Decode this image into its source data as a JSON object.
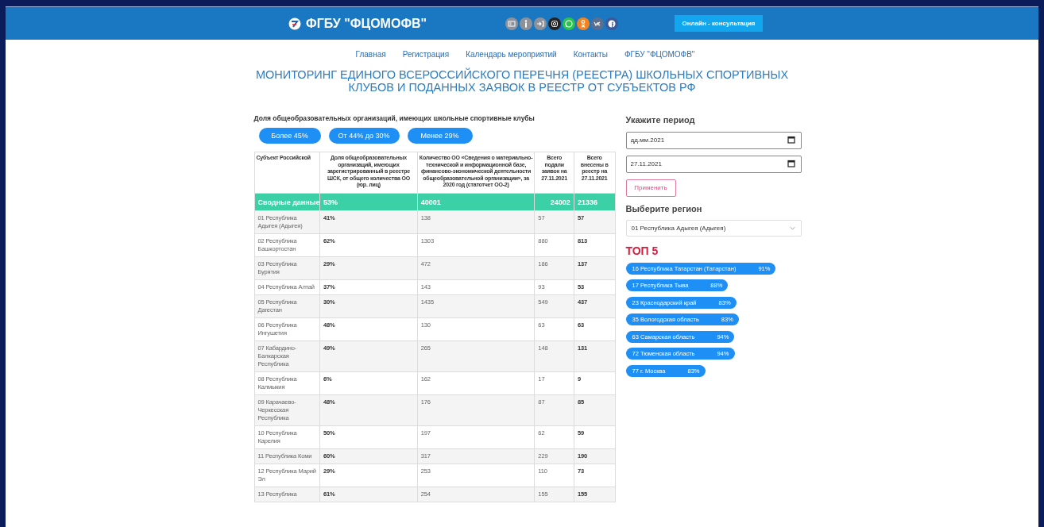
{
  "header": {
    "title": "ФГБУ \"ФЦОМОФВ\"",
    "button": "Онлайн - консультация"
  },
  "nav": [
    "Главная",
    "Регистрация",
    "Календарь мероприятий",
    "Контакты",
    "ФГБУ \"ФЦОМОФВ\""
  ],
  "page_title": "МОНИТОРИНГ ЕДИНОГО ВСЕРОССИЙСКОГО ПЕРЕЧНЯ (РЕЕСТРА) ШКОЛЬНЫХ СПОРТИВНЫХ КЛУБОВ И ПОДАННЫХ ЗАЯВОК В РЕЕСТР ОТ СУБЪЕКТОВ РФ",
  "filter": {
    "label": "Доля общеобразовательных организаций, имеющих школьные спортивные клубы",
    "buttons": [
      "Более 45%",
      "От 44% до 30%",
      "Менее 29%"
    ]
  },
  "table": {
    "columns": [
      "Субъект Российской",
      "Доля общеобразовательных организаций, имеющих зарегистрированный в реестре ШСК, от общего количества ОО (юр. лиц)",
      "Количество ОО «Сведения о материально-технической и информационной базе, финансово-экономической деятельности общеобразовательной организации», за 2020 год (статотчет ОО-2)",
      "Всего подали заявок на 27.11.2021",
      "Всего внесены в реестр на 27.11.2021"
    ],
    "summary": [
      "Сводные данные",
      "53%",
      "40001",
      "24002",
      "21336"
    ],
    "rows": [
      [
        "01 Республика Адыгея (Адыгея)",
        "41%",
        "138",
        "57",
        "57"
      ],
      [
        "02 Республика Башкортостан",
        "62%",
        "1303",
        "880",
        "813"
      ],
      [
        "03 Республика Бурятия",
        "29%",
        "472",
        "186",
        "137"
      ],
      [
        "04 Республика Алтай",
        "37%",
        "143",
        "93",
        "53"
      ],
      [
        "05 Республика Дагестан",
        "30%",
        "1435",
        "549",
        "437"
      ],
      [
        "06 Республика Ингушетия",
        "48%",
        "130",
        "63",
        "63"
      ],
      [
        "07 Кабардино-Балкарская Республика",
        "49%",
        "265",
        "148",
        "131"
      ],
      [
        "08 Республика Калмыкия",
        "6%",
        "162",
        "17",
        "9"
      ],
      [
        "09 Карачаево-Черкесская Республика",
        "48%",
        "176",
        "87",
        "85"
      ],
      [
        "10 Республика Карелия",
        "50%",
        "197",
        "62",
        "59"
      ],
      [
        "11 Республика Коми",
        "60%",
        "317",
        "229",
        "190"
      ],
      [
        "12 Республика Марий Эл",
        "29%",
        "253",
        "110",
        "73"
      ],
      [
        "13 Республика",
        "61%",
        "254",
        "155",
        "155"
      ]
    ]
  },
  "sidebar": {
    "period_label": "Укажите период",
    "date_from": {
      "value": "дд.мм.2021"
    },
    "date_to": {
      "value": "27.11.2021"
    },
    "apply_button": "Применить",
    "region_label": "Выберите регион",
    "region_select": {
      "value": "01 Республика Адыгея (Адыгея)"
    },
    "top_title": "ТОП 5",
    "top": [
      {
        "name": "16 Республика Татарстан (Татарстан)",
        "percent": "91%"
      },
      {
        "name": "17 Республика Тыва",
        "percent": "88%"
      },
      {
        "name": "23 Краснодарский край",
        "percent": "83%"
      },
      {
        "name": "35 Вологодская область",
        "percent": "83%"
      },
      {
        "name": "63 Самарская область",
        "percent": "94%"
      },
      {
        "name": "72 Тюменская область",
        "percent": "94%"
      },
      {
        "name": "77 г. Москва",
        "percent": "83%"
      }
    ]
  }
}
